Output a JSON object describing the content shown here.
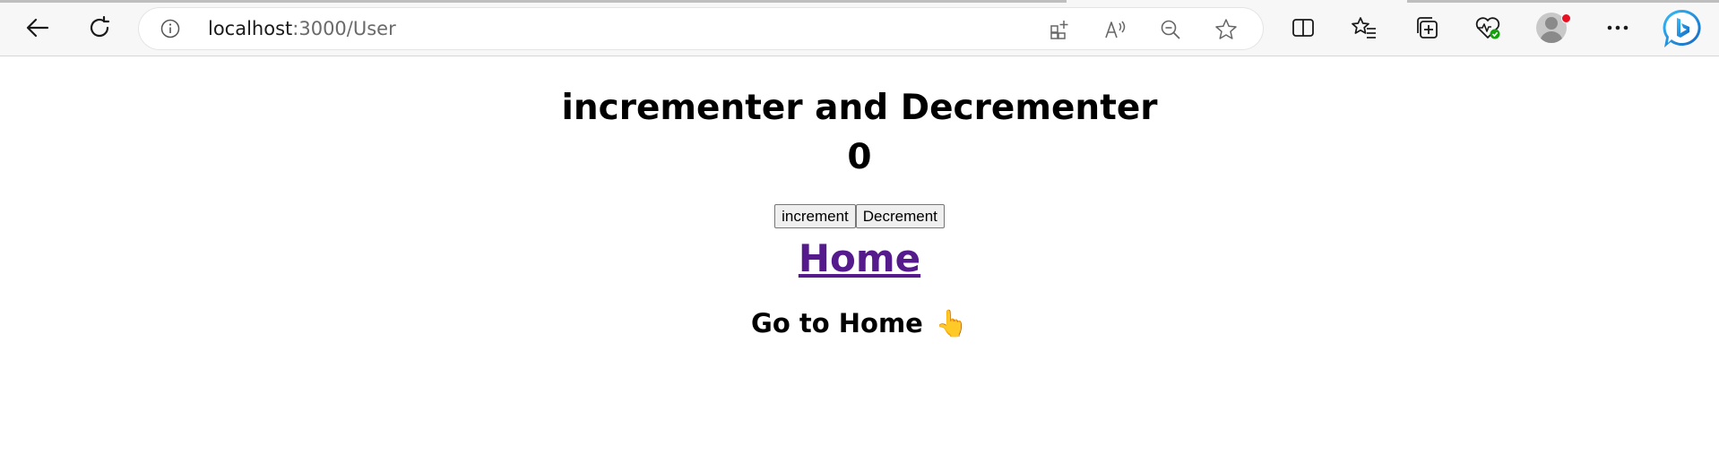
{
  "browser": {
    "url_host": "localhost",
    "url_path": ":3000/User",
    "icons": {
      "back": "back-arrow-icon",
      "refresh": "refresh-icon",
      "site_info": "info-icon",
      "app_available": "app-add-icon",
      "read_aloud": "read-aloud-icon",
      "zoom": "zoom-out-icon",
      "favorite": "star-icon",
      "split_screen": "split-screen-icon",
      "favorites": "favorites-icon",
      "collections": "collections-icon",
      "performance": "heart-pulse-icon",
      "profile": "profile-avatar-icon",
      "more": "more-icon",
      "copilot": "copilot-icon"
    },
    "colors": {
      "toolbar_bg": "#f7f7f7",
      "notification_dot": "#e81123",
      "copilot_blue": "#1e88e5"
    }
  },
  "page": {
    "title": "incrementer and Decrementer",
    "count": "0",
    "increment_label": "increment",
    "decrement_label": "Decrement",
    "home_link_label": "Home",
    "go_to_home_text": "Go to Home",
    "go_to_home_emoji": "👆",
    "link_color": "#551a8b"
  }
}
